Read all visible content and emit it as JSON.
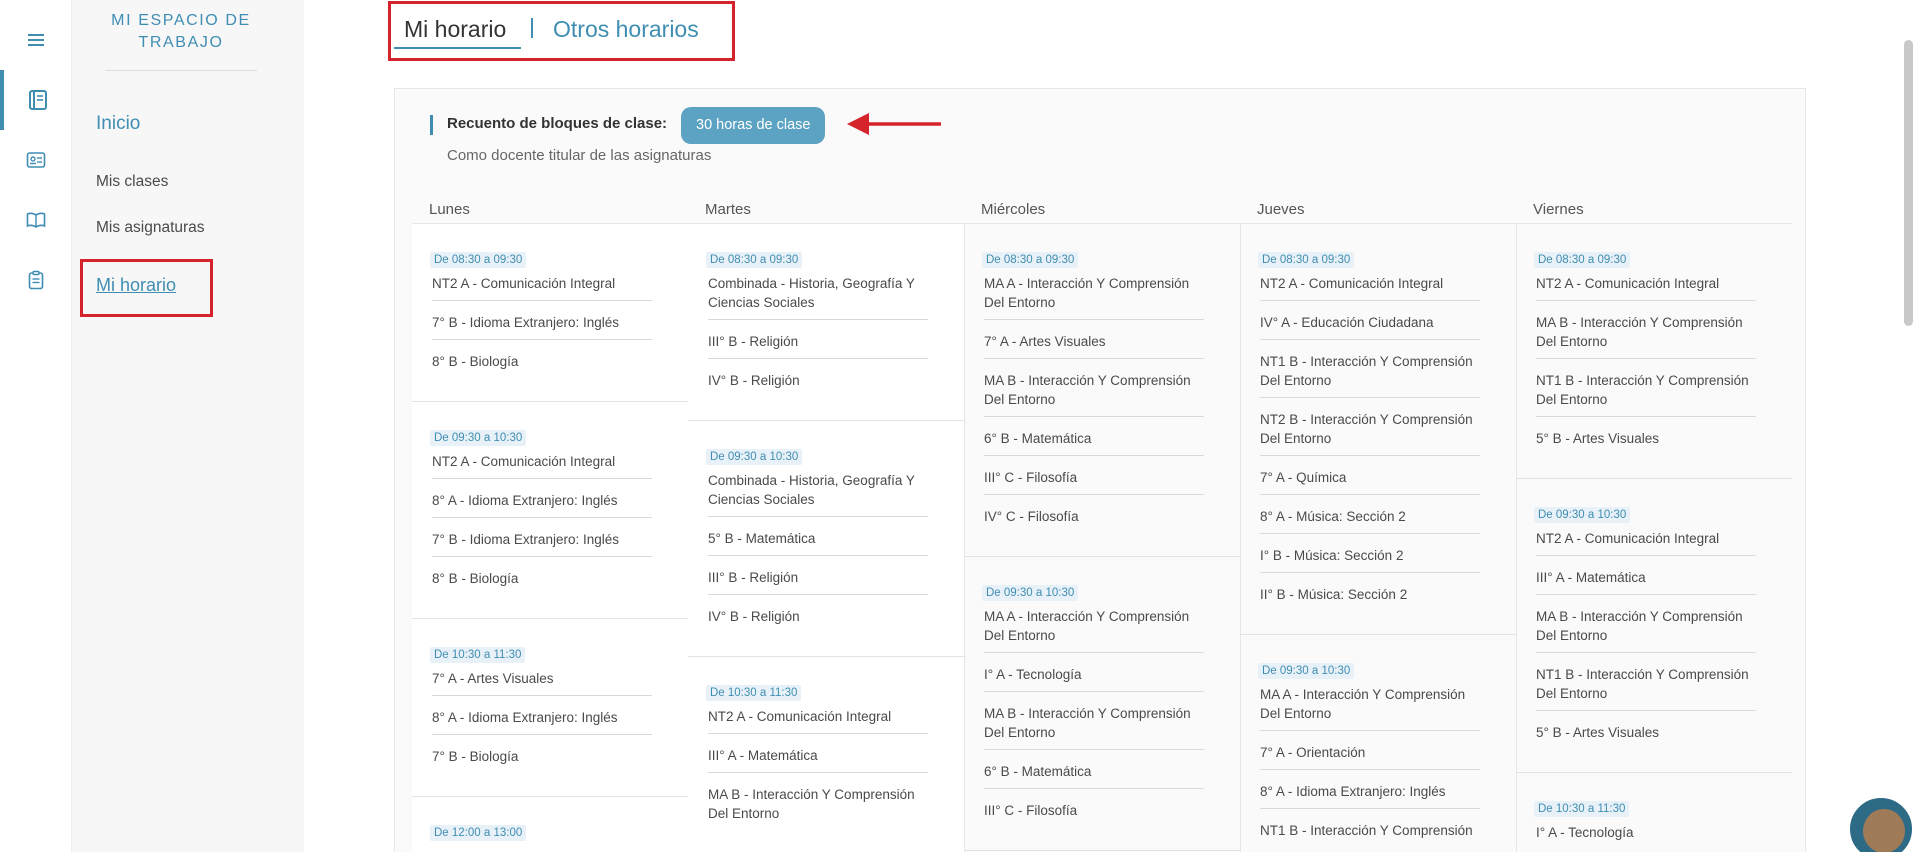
{
  "sidebar": {
    "workspace_title": "MI ESPACIO DE TRABAJO",
    "home": "Inicio",
    "items": [
      "Mis clases",
      "Mis asignaturas"
    ],
    "active_item": "Mi horario"
  },
  "rail": {
    "icons": [
      "menu-icon",
      "notebook-icon",
      "id-card-icon",
      "book-icon",
      "clipboard-icon"
    ]
  },
  "tabs": {
    "mine": "Mi horario",
    "other": "Otros horarios"
  },
  "summary": {
    "label": "Recuento de bloques de clase:",
    "hours_badge": "30 horas de clase",
    "subtitle": "Como docente titular de las asignaturas"
  },
  "colors": {
    "accent": "#3f8eb2",
    "annotation_red": "#d4232a"
  },
  "days": [
    {
      "name": "Lunes",
      "blocks": [
        {
          "time": "De 08:30 a 09:30",
          "classes": [
            "NT2 A - Comunicación Integral",
            "7° B - Idioma Extranjero: Inglés",
            "8° B - Biología"
          ]
        },
        {
          "time": "De 09:30 a 10:30",
          "classes": [
            "NT2 A - Comunicación Integral",
            "8° A - Idioma Extranjero: Inglés",
            "7° B - Idioma Extranjero: Inglés",
            "8° B - Biología"
          ]
        },
        {
          "time": "De 10:30 a 11:30",
          "classes": [
            "7° A - Artes Visuales",
            "8° A - Idioma Extranjero: Inglés",
            "7° B - Biología"
          ]
        },
        {
          "time": "De 12:00 a 13:00",
          "classes": []
        }
      ]
    },
    {
      "name": "Martes",
      "blocks": [
        {
          "time": "De 08:30 a 09:30",
          "classes": [
            "Combinada - Historia, Geografía Y Ciencias Sociales",
            "III° B - Religión",
            "IV° B - Religión"
          ]
        },
        {
          "time": "De 09:30 a 10:30",
          "classes": [
            "Combinada - Historia, Geografía Y Ciencias Sociales",
            "5° B - Matemática",
            "III° B - Religión",
            "IV° B - Religión"
          ]
        },
        {
          "time": "De 10:30 a 11:30",
          "classes": [
            "NT2 A - Comunicación Integral",
            "III° A - Matemática",
            "MA B - Interacción Y Comprensión Del Entorno"
          ]
        }
      ]
    },
    {
      "name": "Miércoles",
      "blocks": [
        {
          "time": "De 08:30 a 09:30",
          "classes": [
            "MA A - Interacción Y Comprensión Del Entorno",
            "7° A - Artes Visuales",
            "MA B - Interacción Y Comprensión Del Entorno",
            "6° B - Matemática",
            "III° C - Filosofía",
            "IV° C - Filosofía"
          ]
        },
        {
          "time": "De 09:30 a 10:30",
          "classes": [
            "MA A - Interacción Y Comprensión Del Entorno",
            "I° A - Tecnología",
            "MA B - Interacción Y Comprensión Del Entorno",
            "6° B - Matemática",
            "III° C - Filosofía"
          ]
        }
      ]
    },
    {
      "name": "Jueves",
      "blocks": [
        {
          "time": "De 08:30 a 09:30",
          "classes": [
            "NT2 A - Comunicación Integral",
            "IV° A - Educación Ciudadana",
            "NT1 B - Interacción Y Comprensión Del Entorno",
            "NT2 B - Interacción Y Comprensión Del Entorno",
            "7° A - Química",
            "8° A - Música: Sección 2",
            "I° B - Música: Sección 2",
            "II° B - Música: Sección 2"
          ]
        },
        {
          "time": "De 09:30 a 10:30",
          "classes": [
            "MA A - Interacción Y Comprensión Del Entorno",
            "7° A - Orientación",
            "8° A - Idioma Extranjero: Inglés",
            "NT1 B - Interacción Y Comprensión"
          ]
        }
      ]
    },
    {
      "name": "Viernes",
      "blocks": [
        {
          "time": "De 08:30 a 09:30",
          "classes": [
            "NT2 A - Comunicación Integral",
            "MA B - Interacción Y Comprensión Del Entorno",
            "NT1 B - Interacción Y Comprensión Del Entorno",
            "5° B - Artes Visuales"
          ]
        },
        {
          "time": "De 09:30 a 10:30",
          "classes": [
            "NT2 A - Comunicación Integral",
            "III° A - Matemática",
            "MA B - Interacción Y Comprensión Del Entorno",
            "NT1 B - Interacción Y Comprensión Del Entorno",
            "5° B - Artes Visuales"
          ]
        },
        {
          "time": "De 10:30 a 11:30",
          "classes": [
            "I° A - Tecnología"
          ]
        }
      ]
    }
  ]
}
